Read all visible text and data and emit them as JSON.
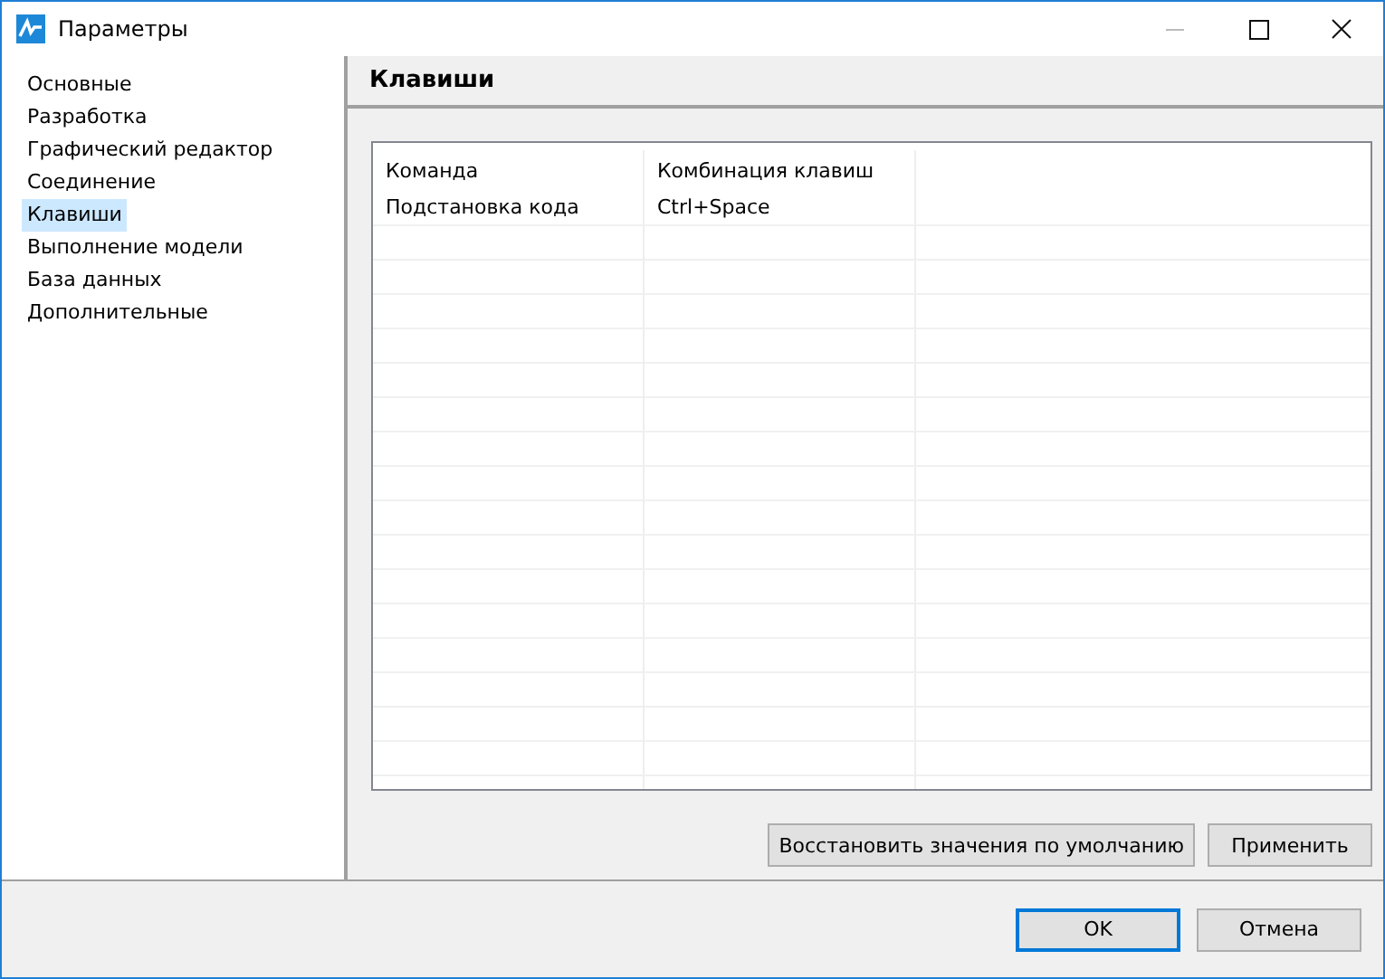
{
  "window": {
    "title": "Параметры"
  },
  "sidebar": {
    "items": [
      {
        "label": "Основные",
        "selected": false
      },
      {
        "label": "Разработка",
        "selected": false
      },
      {
        "label": "Графический редактор",
        "selected": false
      },
      {
        "label": "Соединение",
        "selected": false
      },
      {
        "label": "Клавиши",
        "selected": true
      },
      {
        "label": "Выполнение модели",
        "selected": false
      },
      {
        "label": "База данных",
        "selected": false
      },
      {
        "label": "Дополнительные",
        "selected": false
      }
    ]
  },
  "section": {
    "title": "Клавиши"
  },
  "table": {
    "columns": [
      "Команда",
      "Комбинация клавиш"
    ],
    "rows": [
      [
        "Подстановка кода",
        "Ctrl+Space"
      ]
    ]
  },
  "panel_buttons": [
    "Восстановить значения по умолчанию",
    "Применить"
  ],
  "dialog_buttons": [
    {
      "label": "OK",
      "default": true
    },
    {
      "label": "Отмена",
      "default": false
    }
  ]
}
